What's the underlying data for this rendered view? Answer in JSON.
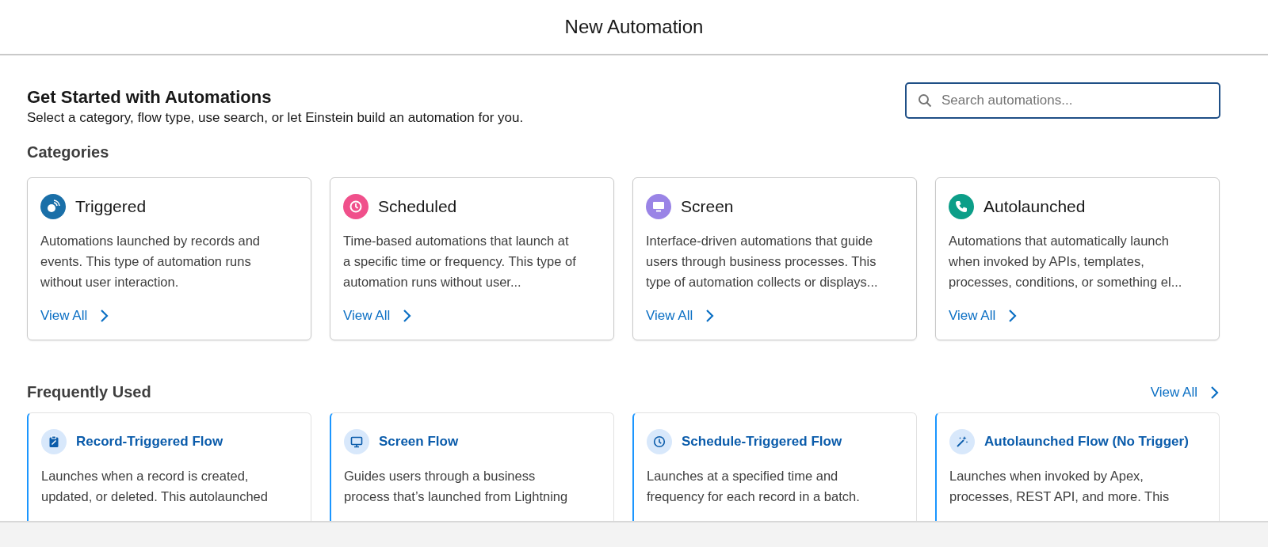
{
  "window": {
    "title": "New Automation"
  },
  "intro": {
    "title": "Get Started with Automations",
    "subtitle": "Select a category, flow type, use search, or let Einstein build an automation for you."
  },
  "search": {
    "placeholder": "Search automations..."
  },
  "categories": {
    "heading": "Categories",
    "items": [
      {
        "kind": "triggered",
        "title": "Triggered",
        "color": "#1a6fa8",
        "lines": [
          "Automations launched by records and",
          "events. This type of automation runs",
          "without user interaction."
        ],
        "link": "View All"
      },
      {
        "kind": "scheduled",
        "title": "Scheduled",
        "color": "#f0508b",
        "lines": [
          "Time-based automations that launch at",
          "a specific time or frequency. This type of",
          "automation runs without user..."
        ],
        "link": "View All"
      },
      {
        "kind": "screen",
        "title": "Screen",
        "color": "#9a84e6",
        "lines": [
          "Interface-driven automations that guide",
          "users through business processes. This",
          "type of automation collects or displays..."
        ],
        "link": "View All"
      },
      {
        "kind": "autolaunched",
        "title": "Autolaunched",
        "color": "#0c9e88",
        "lines": [
          "Automations that automatically launch",
          "when invoked by APIs, templates,",
          "processes, conditions, or something el..."
        ],
        "link": "View All"
      }
    ]
  },
  "frequently_used": {
    "heading": "Frequently Used",
    "link": "View All",
    "items": [
      {
        "kind": "record",
        "title": "Record-Triggered Flow",
        "lines": [
          "Launches when a record is created,",
          "updated, or deleted. This autolaunched"
        ]
      },
      {
        "kind": "screen",
        "title": "Screen Flow",
        "lines": [
          "Guides users through a business",
          "process that’s launched from Lightning"
        ]
      },
      {
        "kind": "schedule",
        "title": "Schedule-Triggered Flow",
        "lines": [
          "Launches at a specified time and",
          "frequency for each record in a batch."
        ]
      },
      {
        "kind": "autolaunched",
        "title": "Autolaunched Flow (No Trigger)",
        "lines": [
          "Launches when invoked by Apex,",
          "processes, REST API, and more. This"
        ]
      }
    ]
  }
}
